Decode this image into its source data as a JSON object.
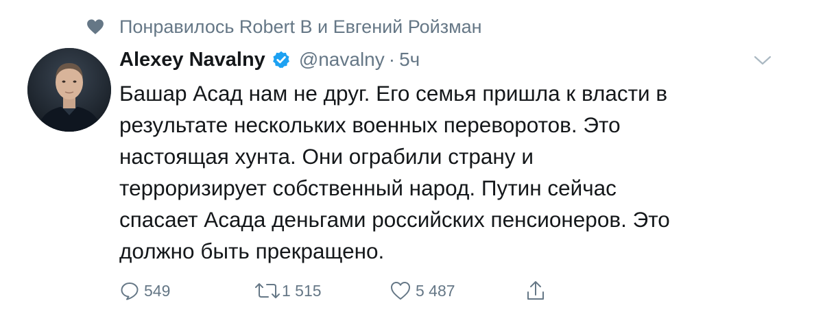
{
  "social_context": {
    "text": "Понравилось Robert B и Евгений Ройзман",
    "icon": "heart-icon"
  },
  "tweet": {
    "author_name": "Alexey Navalny",
    "verified": true,
    "handle": "@navalny",
    "separator": "·",
    "time": "5ч",
    "text_lines": [
      "Башар Асад нам не друг. Его семья пришла к власти в",
      "результате нескольких военных переворотов. Это",
      "настоящая хунта. Они ограбили страну и",
      "терроризирует собственный народ. Путин сейчас",
      "спасает Асада деньгами российских пенсионеров. Это",
      "должно быть прекращено."
    ]
  },
  "actions": {
    "reply_count": "549",
    "retweet_count": "1 515",
    "like_count": "5 487"
  },
  "colors": {
    "text_primary": "#14171a",
    "text_secondary": "#657786",
    "verified_blue": "#1da1f2",
    "background": "#ffffff"
  }
}
